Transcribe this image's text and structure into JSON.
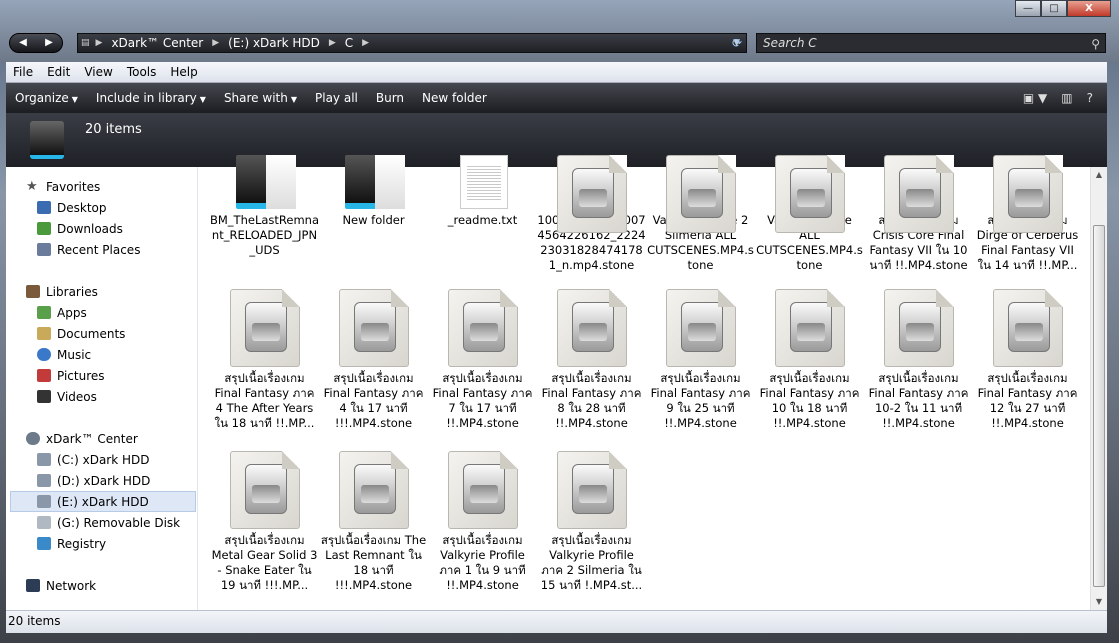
{
  "window": {
    "min": "—",
    "max": "□",
    "close": "X"
  },
  "nav": {
    "back": "◀",
    "forward": "▶"
  },
  "address": {
    "crumbs": [
      "xDark™ Center",
      "(E:) xDark HDD",
      "C"
    ]
  },
  "search": {
    "placeholder": "Search C"
  },
  "menu": [
    "File",
    "Edit",
    "View",
    "Tools",
    "Help"
  ],
  "commands": {
    "organize": "Organize",
    "include": "Include in library",
    "share": "Share with",
    "play": "Play all",
    "burn": "Burn",
    "newfolder": "New folder"
  },
  "header": {
    "count": "20 items"
  },
  "sidebar": {
    "favorites": {
      "title": "Favorites",
      "items": [
        "Desktop",
        "Downloads",
        "Recent Places"
      ]
    },
    "libraries": {
      "title": "Libraries",
      "items": [
        "Apps",
        "Documents",
        "Music",
        "Pictures",
        "Videos"
      ]
    },
    "computer": {
      "title": "xDark™ Center",
      "items": [
        "(C:) xDark HDD",
        "(D:) xDark HDD",
        "(E:) xDark HDD",
        "(G:) Removable Disk",
        "Registry"
      ]
    },
    "network": {
      "title": "Network"
    }
  },
  "files": [
    {
      "type": "folder",
      "name": "BM_TheLastRemnant_RELOADED_JPN_UDS"
    },
    {
      "type": "folder",
      "name": "New folder"
    },
    {
      "type": "txt",
      "name": "_readme.txt"
    },
    {
      "type": "stone",
      "name": "10000000_2260074564226162_2224230318284741781_n.mp4.stone"
    },
    {
      "type": "stone",
      "name": "Valkyrie Profile 2 Silmeria ALL CUTSCENES.MP4.stone"
    },
    {
      "type": "stone",
      "name": "Valkyrie Profile ALL CUTSCENES.MP4.stone"
    },
    {
      "type": "stone",
      "name": "สรุปเนื้อเรื่องเกม Crisis Core Final Fantasy VII ใน 10 นาที !!.MP4.stone"
    },
    {
      "type": "stone",
      "name": "สรุปเนื้อเรื่องเกม Dirge of Cerberus Final Fantasy VII ใน 14 นาที !!.MP..."
    },
    {
      "type": "stone",
      "name": "สรุปเนื้อเรื่องเกม Final Fantasy ภาค 4 The After Years ใน 18 นาที !!.MP..."
    },
    {
      "type": "stone",
      "name": "สรุปเนื้อเรื่องเกม Final Fantasy ภาค 4 ใน 17 นาที !!!.MP4.stone"
    },
    {
      "type": "stone",
      "name": "สรุปเนื้อเรื่องเกม Final Fantasy ภาค 7 ใน 17 นาที !!.MP4.stone"
    },
    {
      "type": "stone",
      "name": "สรุปเนื้อเรื่องเกม Final Fantasy ภาค 8 ใน 28 นาที !!.MP4.stone"
    },
    {
      "type": "stone",
      "name": "สรุปเนื้อเรื่องเกม Final Fantasy ภาค 9 ใน 25 นาที !!.MP4.stone"
    },
    {
      "type": "stone",
      "name": "สรุปเนื้อเรื่องเกม Final Fantasy ภาค 10 ใน 18 นาที !!.MP4.stone"
    },
    {
      "type": "stone",
      "name": "สรุปเนื้อเรื่องเกม Final Fantasy ภาค 10-2 ใน 11 นาที !!.MP4.stone"
    },
    {
      "type": "stone",
      "name": "สรุปเนื้อเรื่องเกม Final Fantasy ภาค 12 ใน 27 นาที !!.MP4.stone"
    },
    {
      "type": "stone",
      "name": "สรุปเนื้อเรื่องเกม Metal Gear Solid 3 - Snake Eater ใน 19 นาที !!!.MP..."
    },
    {
      "type": "stone",
      "name": "สรุปเนื้อเรื่องเกม The Last Remnant ใน 18 นาที !!!.MP4.stone"
    },
    {
      "type": "stone",
      "name": "สรุปเนื้อเรื่องเกม Valkyrie Profile ภาค 1 ใน 9 นาที !!.MP4.stone"
    },
    {
      "type": "stone",
      "name": "สรุปเนื้อเรื่องเกม Valkyrie Profile ภาค 2 Silmeria ใน 15 นาที !.MP4.st..."
    }
  ],
  "status": {
    "count": "20 items"
  },
  "colors": {
    "accent": "#27b6e8",
    "selection": "#dde7f5"
  }
}
